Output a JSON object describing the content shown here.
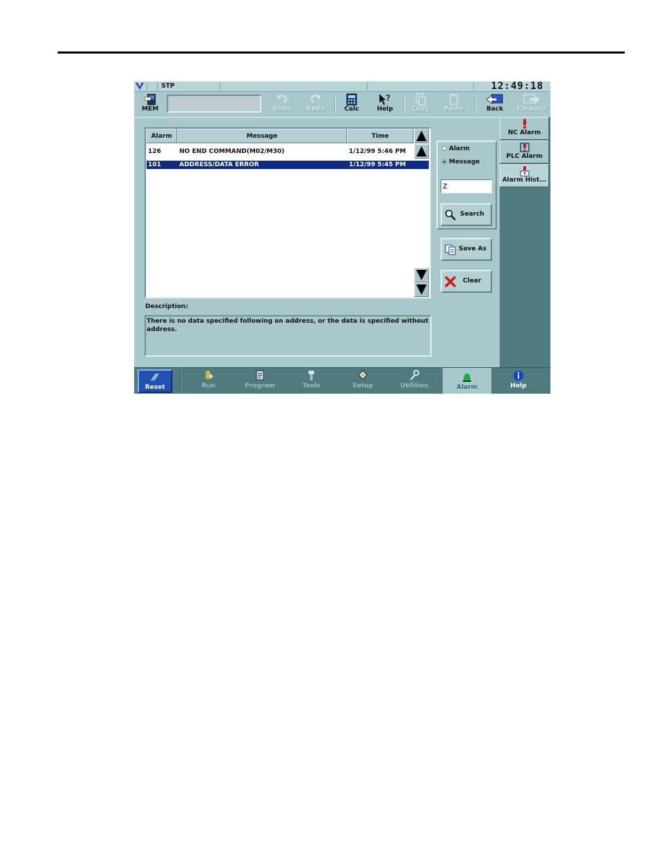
{
  "status": {
    "mode": "STP",
    "clock": "12:49:18"
  },
  "toolbar": {
    "mem_label": "MEM",
    "undo": "Undo",
    "redo": "Redo",
    "calc": "Calc",
    "help": "Help",
    "copy": "Copy",
    "paste": "Paste",
    "back": "Back",
    "forward": "Forward"
  },
  "table": {
    "headers": [
      "Alarm",
      "Message",
      "Time"
    ],
    "rows": [
      {
        "alarm": "126",
        "message": "NO END COMMAND(M02/M30)",
        "time": "1/12/99 5:46 PM"
      },
      {
        "alarm": "101",
        "message": "ADDRESS/DATA ERROR",
        "time": "1/12/99 5:45 PM"
      }
    ]
  },
  "description": {
    "label": "Description:",
    "text": "There is no data specified following an address, or the data is specified without address."
  },
  "search": {
    "radio_alarm": "Alarm",
    "radio_message": "Message",
    "selected": "Message",
    "input_value": "Z",
    "search_button": "Search",
    "save_as_button": "Save As",
    "clear_button": "Clear"
  },
  "sidetabs": {
    "nc_alarm": "NC Alarm",
    "plc_alarm": "PLC Alarm",
    "alarm_history": "Alarm Hist..."
  },
  "nav": {
    "reset": "Reset",
    "run": "Run",
    "program": "Program",
    "tools": "Tools",
    "setup": "Setup",
    "utilities": "Utilities",
    "alarm": "Alarm",
    "help": "Help"
  },
  "colors": {
    "screen_bg": "#a9c8cc",
    "selection": "#0b2a8a",
    "nav_bg": "#4e7b7d",
    "reset_btn": "#1f52b3"
  }
}
